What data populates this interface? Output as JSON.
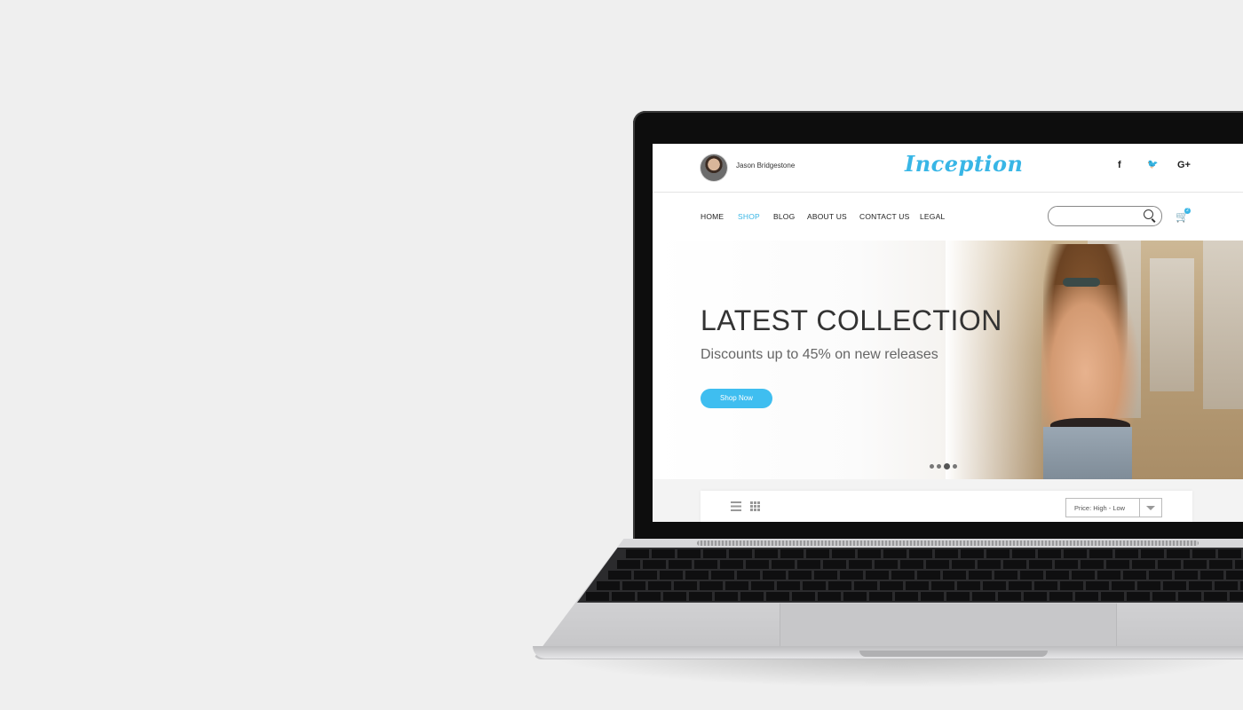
{
  "header": {
    "user_name": "Jason Bridgestone",
    "logo": "Inception",
    "social": [
      {
        "icon": "facebook-icon",
        "glyph": "f"
      },
      {
        "icon": "twitter-icon",
        "glyph": "🐦"
      },
      {
        "icon": "google-plus-icon",
        "glyph": "G+"
      }
    ]
  },
  "nav": {
    "items": [
      "HOME",
      "SHOP",
      "BLOG",
      "ABOUT US",
      "CONTACT US",
      "LEGAL"
    ],
    "active": "SHOP",
    "search_placeholder": "",
    "cart_count": "2"
  },
  "hero": {
    "title": "LATEST COLLECTION",
    "subtitle": "Discounts up to 45% on new releases",
    "button": "Shop Now",
    "slides": 4,
    "active_slide": 3
  },
  "toolbar": {
    "sort_selected": "Price: High - Low"
  },
  "colors": {
    "accent": "#38b6e6",
    "button": "#3fbef0",
    "background": "#efefef"
  }
}
